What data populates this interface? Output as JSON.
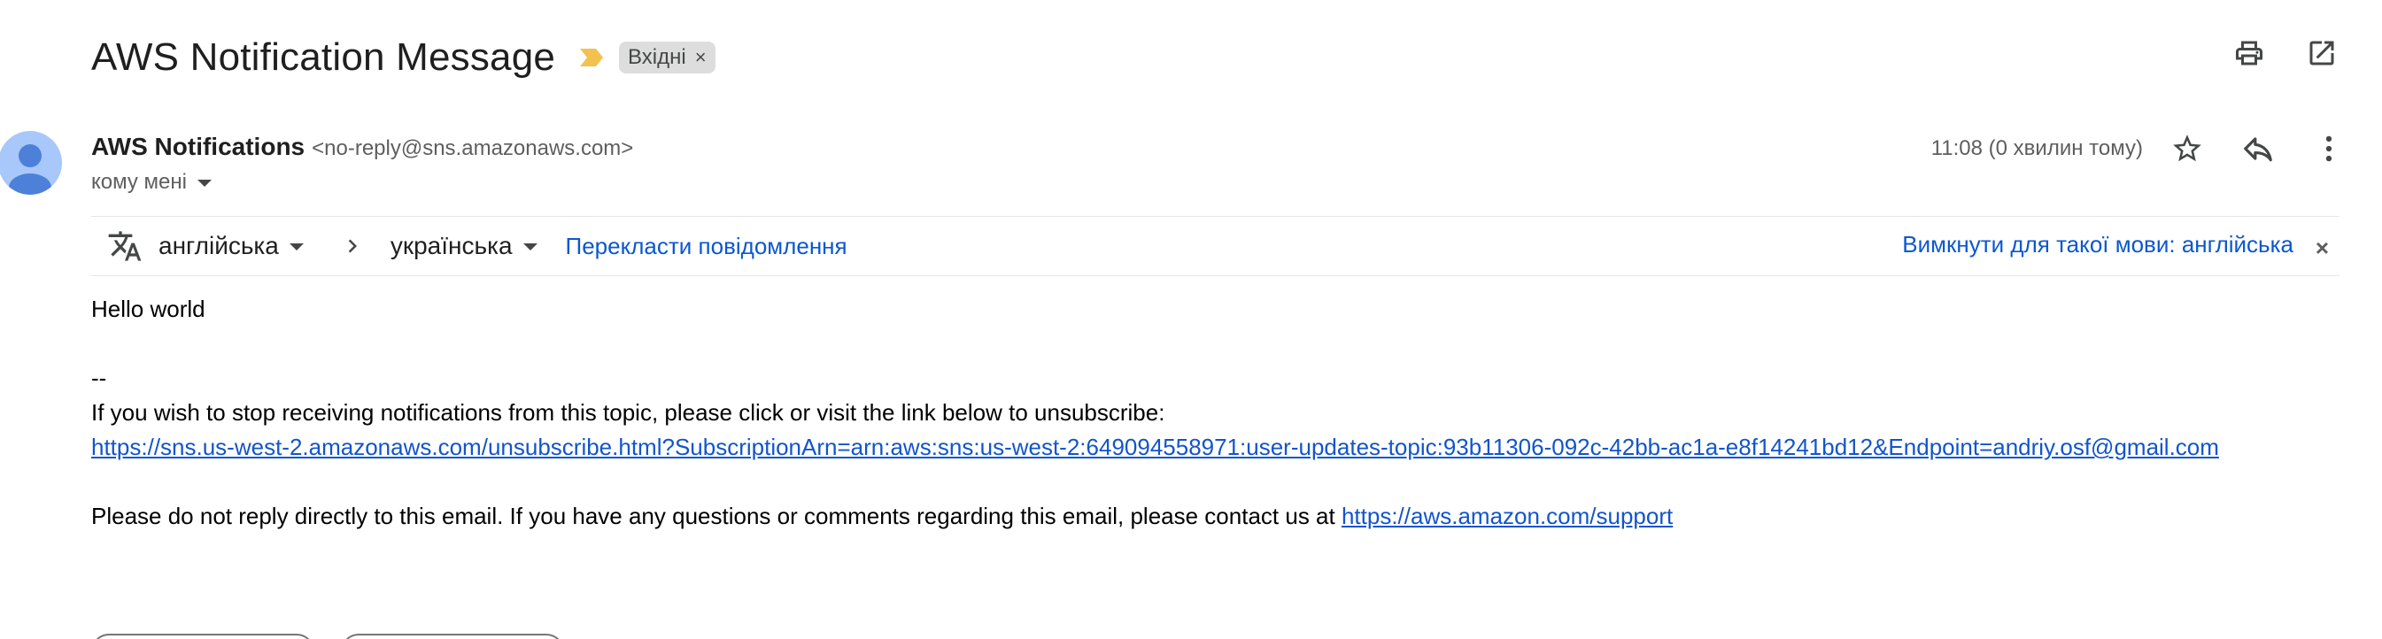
{
  "email": {
    "subject": "AWS Notification Message",
    "label": "Вхідні",
    "label_remove": "×",
    "sender_name": "AWS Notifications",
    "sender_email": "<no-reply@sns.amazonaws.com>",
    "to_label": "кому мені",
    "time": "11:08 (0 хвилин тому)"
  },
  "translate": {
    "from_lang": "англійська",
    "to_lang": "українська",
    "translate_link": "Перекласти повідомлення",
    "turn_off": "Вимкнути для такої мови: англійська",
    "close": "×"
  },
  "body": {
    "line1": "Hello world",
    "separator": "--",
    "unsubscribe_text": "If you wish to stop receiving notifications from this topic, please click or visit the link below to unsubscribe:",
    "unsubscribe_link": "https://sns.us-west-2.amazonaws.com/unsubscribe.html?SubscriptionArn=arn:aws:sns:us-west-2:649094558971:user-updates-topic:93b11306-092c-42bb-ac1a-e8f14241bd12&Endpoint=andriy.osf@gmail.com",
    "noreply_text": "Please do not reply directly to this email. If you have any questions or comments regarding this email, please contact us at ",
    "support_link": "https://aws.amazon.com/support"
  },
  "icons": {
    "importance": "importance-marker-icon",
    "print": "print-icon",
    "open_new": "open-in-new-window-icon",
    "star": "star-icon",
    "reply": "reply-icon",
    "more": "more-vert-icon",
    "translate": "translate-icon",
    "chevron": "chevron-right-icon"
  },
  "colors": {
    "link": "#1155cc",
    "accent_link": "#0b57d0",
    "importance": "#f2c14e",
    "avatar_bg": "#a8c7fa",
    "avatar_fg": "#4d80d8"
  }
}
